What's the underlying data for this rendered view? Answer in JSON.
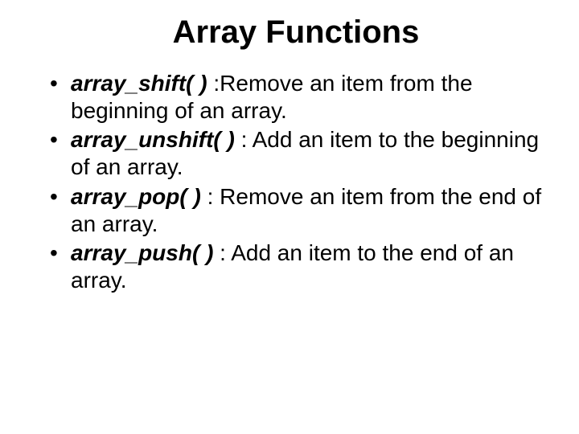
{
  "title": "Array Functions",
  "items": [
    {
      "fn": "array_shift( )",
      "desc": " :Remove an item from the beginning of an array."
    },
    {
      "fn": "array_unshift( )",
      "desc": " : Add an item to the beginning of an array."
    },
    {
      "fn": "array_pop( )",
      "desc": " : Remove an item from the end of an array."
    },
    {
      "fn": "array_push( )",
      "desc": " : Add an item to the end of an array."
    }
  ]
}
